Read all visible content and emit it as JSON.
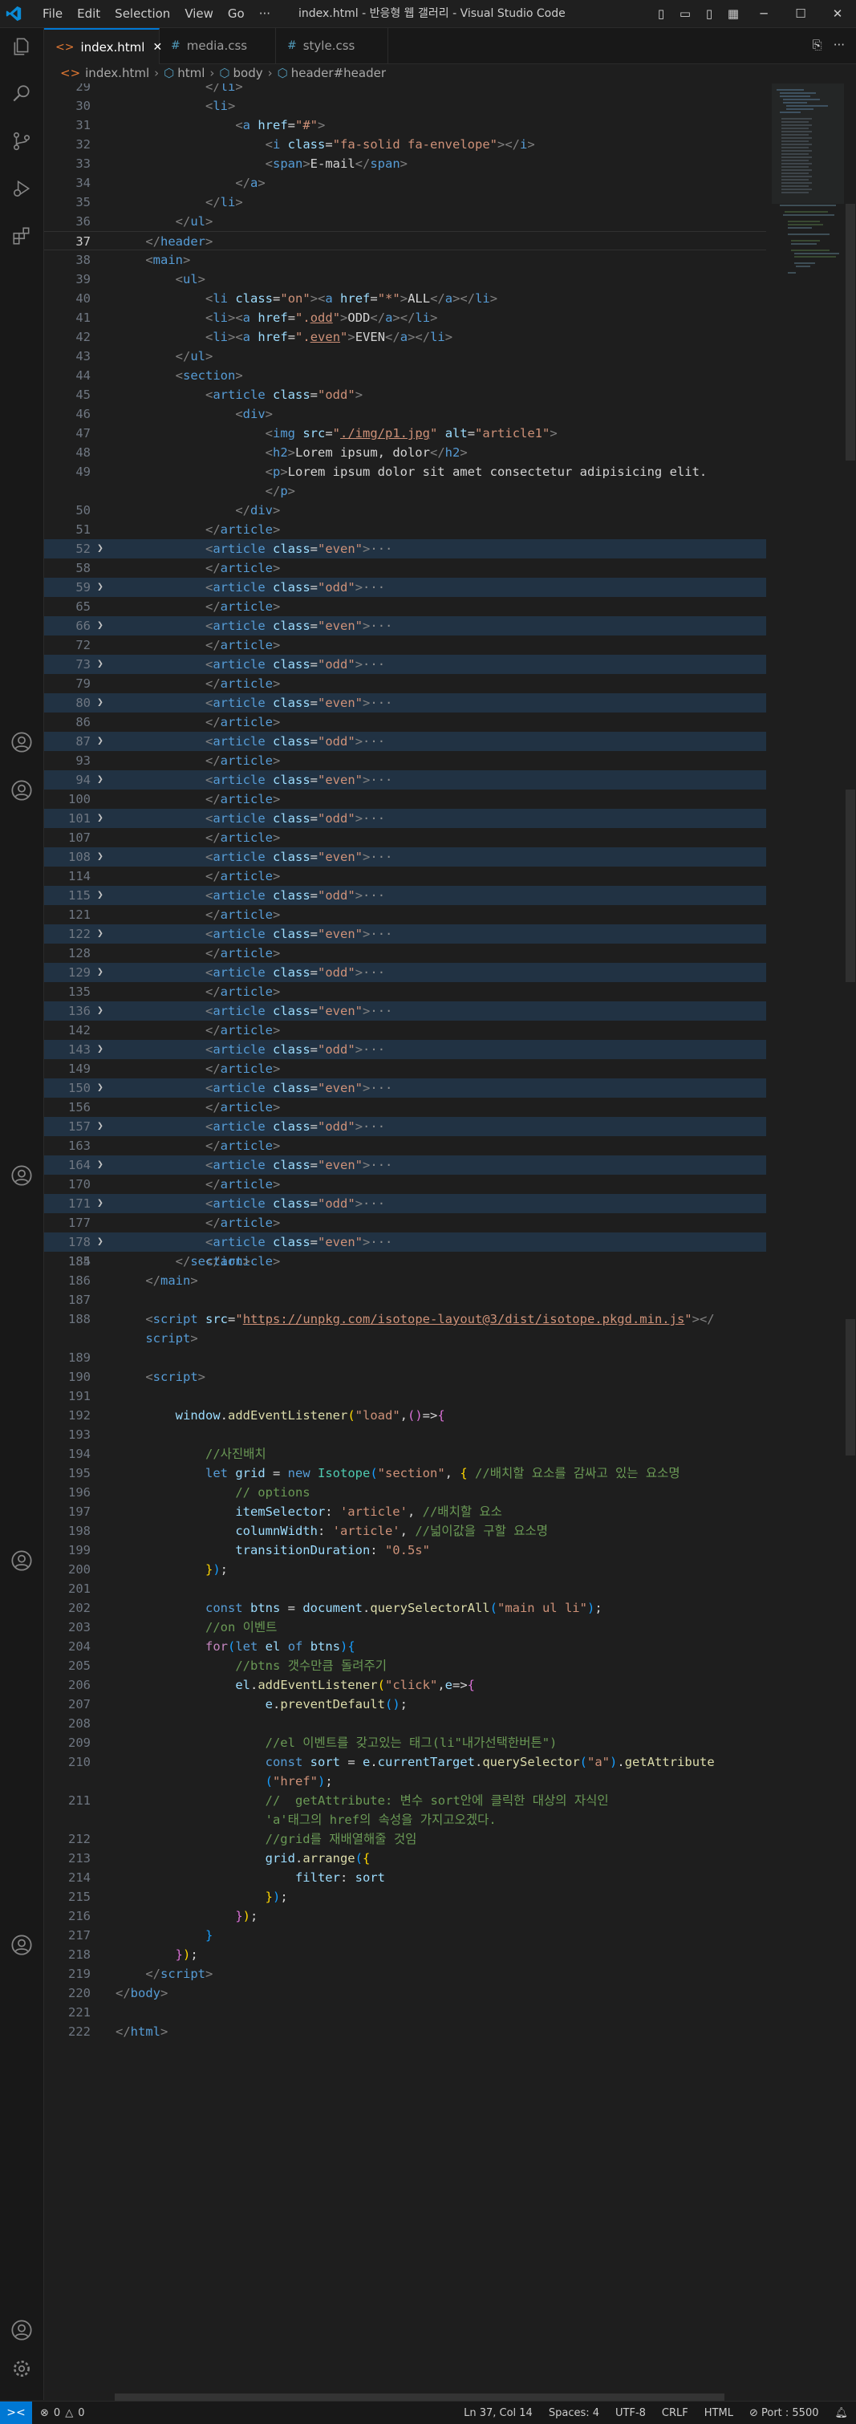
{
  "window": {
    "title": "index.html - 반응형 웹 갤러리 - Visual Studio Code"
  },
  "menu": [
    "File",
    "Edit",
    "Selection",
    "View",
    "Go",
    "···"
  ],
  "tabs": [
    {
      "label": "index.html",
      "icon": "html-icon",
      "active": true
    },
    {
      "label": "media.css",
      "icon": "css-icon",
      "active": false
    },
    {
      "label": "style.css",
      "icon": "css-icon",
      "active": false
    }
  ],
  "breadcrumb": [
    "index.html",
    "html",
    "body",
    "header#header"
  ],
  "status": {
    "errors": "0",
    "warnings": "0",
    "position": "Ln 37, Col 14",
    "spaces": "Spaces: 4",
    "encoding": "UTF-8",
    "eol": "CRLF",
    "language": "HTML",
    "port": "Port : 5500"
  },
  "colors": {
    "accent": "#0078d4",
    "folded_bg": "#213243",
    "editor_bg": "#1e1e1e"
  },
  "icons": [
    "explorer-icon",
    "search-icon",
    "source-control-icon",
    "run-debug-icon",
    "extensions-icon",
    "account-icon",
    "settings-icon"
  ]
}
